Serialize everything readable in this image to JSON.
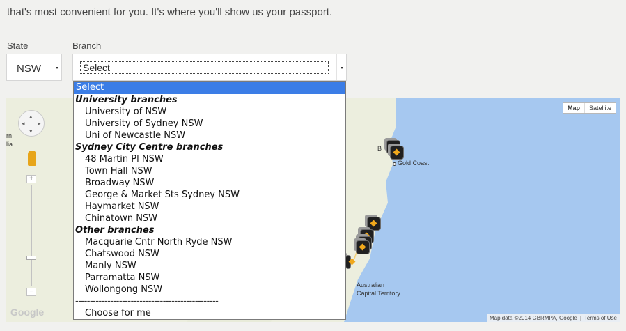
{
  "intro_text": "that's most convenient for you. It's where you'll show us your passport.",
  "state": {
    "label": "State",
    "value": "NSW"
  },
  "branch": {
    "label": "Branch",
    "value": "Select",
    "options": [
      {
        "type": "option",
        "label": "Select",
        "selected": true
      },
      {
        "type": "group",
        "label": "University branches"
      },
      {
        "type": "option",
        "label": "University of NSW"
      },
      {
        "type": "option",
        "label": "University of Sydney NSW"
      },
      {
        "type": "option",
        "label": "Uni of Newcastle NSW"
      },
      {
        "type": "group",
        "label": "Sydney City Centre branches"
      },
      {
        "type": "option",
        "label": "48 Martin Pl NSW"
      },
      {
        "type": "option",
        "label": "Town Hall NSW"
      },
      {
        "type": "option",
        "label": "Broadway NSW"
      },
      {
        "type": "option",
        "label": "George & Market Sts Sydney NSW"
      },
      {
        "type": "option",
        "label": "Haymarket NSW"
      },
      {
        "type": "option",
        "label": "Chinatown NSW"
      },
      {
        "type": "group",
        "label": "Other branches"
      },
      {
        "type": "option",
        "label": "Macquarie Cntr North Ryde NSW"
      },
      {
        "type": "option",
        "label": "Chatswood NSW"
      },
      {
        "type": "option",
        "label": "Manly NSW"
      },
      {
        "type": "option",
        "label": "Parramatta NSW"
      },
      {
        "type": "option",
        "label": "Wollongong NSW"
      },
      {
        "type": "separator",
        "label": "-------------------------------------------------"
      },
      {
        "type": "option",
        "label": "Choose for me"
      }
    ]
  },
  "map": {
    "type_buttons": [
      "Map",
      "Satellite"
    ],
    "labels": {
      "gold_coast": "Gold Coast",
      "b_partial": "B",
      "act_line1": "Australian",
      "act_line2": "Capital Territory",
      "left_n": "rn",
      "left_lia": "lia"
    },
    "attribution": "Map data ©2014 GBRMPA, Google",
    "terms": "Terms of Use",
    "logo": "Google",
    "zoom_in": "+",
    "zoom_out": "−",
    "colors": {
      "water": "#a6c8f0",
      "land": "#eef0e4",
      "marker": "#f0a81c"
    }
  },
  "colors": {
    "selected_option": "#3b7de6",
    "page_bg": "#f1f1ef"
  }
}
